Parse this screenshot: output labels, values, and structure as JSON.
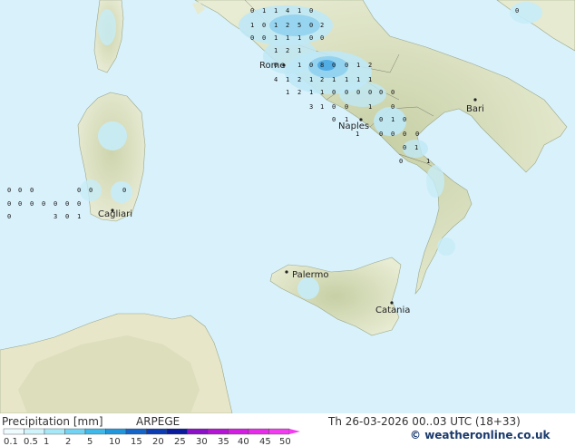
{
  "title": "Precipitation [mm]",
  "model": "ARPEGE",
  "valid_time": "Th 26-03-2026 00..03 UTC (18+33)",
  "copyright": "weatheronline.co.uk",
  "copyright_symbol": "©",
  "legend": {
    "labels": [
      "0.1",
      "0.5",
      "1",
      "2",
      "5",
      "10",
      "15",
      "20",
      "25",
      "30",
      "35",
      "40",
      "45",
      "50"
    ],
    "colors": [
      "#eefcff",
      "#d0f4fc",
      "#a7e8f8",
      "#72d4f2",
      "#3fb8ea",
      "#2196dc",
      "#1565c8",
      "#0c3cb4",
      "#0a1a9c",
      "#8c10c8",
      "#b414d4",
      "#d21ee0",
      "#e62ce8",
      "#f23cf0"
    ]
  },
  "cities": [
    {
      "name": "Rome"
    },
    {
      "name": "Naples"
    },
    {
      "name": "Bari"
    },
    {
      "name": "Cagliari"
    },
    {
      "name": "Palermo"
    },
    {
      "name": "Catania"
    }
  ],
  "precip_values": [
    "0",
    "1",
    "1",
    "4",
    "1",
    "0",
    "1",
    "0",
    "1",
    "2",
    "5",
    "0",
    "2",
    "0",
    "0",
    "1",
    "1",
    "1",
    "0",
    "0",
    "1",
    "2",
    "1",
    "0",
    "1",
    "0",
    "8",
    "0",
    "0",
    "1",
    "2",
    "4",
    "1",
    "2",
    "1",
    "2",
    "1",
    "1",
    "1",
    "1",
    "1",
    "2",
    "1",
    "1",
    "0",
    "0",
    "0",
    "0",
    "0",
    "0",
    "3",
    "1",
    "0",
    "0",
    "1",
    "0",
    "0",
    "1",
    "0",
    "1",
    "0",
    "0",
    "0",
    "0",
    "0",
    "1",
    "0",
    "1",
    "0",
    "0",
    "0",
    "0",
    "0",
    "0",
    "0",
    "0",
    "0",
    "0",
    "0",
    "0",
    "0",
    "0",
    "3",
    "0",
    "1",
    "0",
    "1",
    "0"
  ],
  "colors": {
    "sea": "#d9f1fb",
    "land": "#e9ecd2",
    "land_dark": "#cbd4ae",
    "africa": "#e8e6c8",
    "precip_light": "#bfe8f6",
    "precip_mid": "#8fd0ef",
    "precip_strong": "#4aa9e3"
  }
}
